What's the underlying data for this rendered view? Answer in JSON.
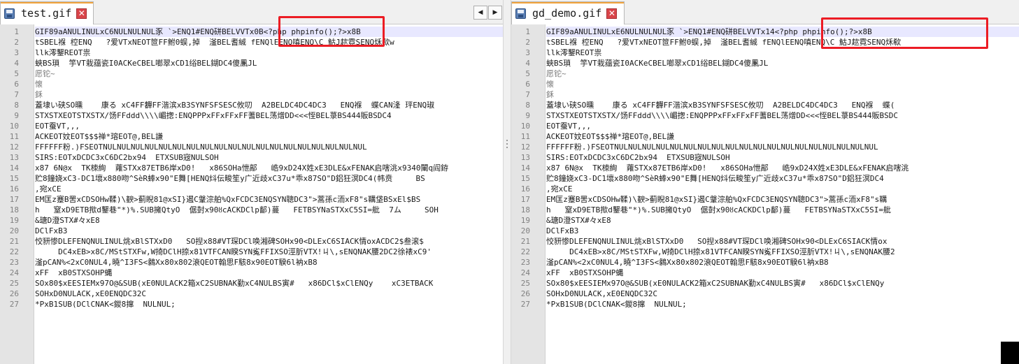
{
  "left_editor": {
    "tab_label": "test.gif",
    "close_symbol": "✕",
    "nav_prev": "◀",
    "nav_next": "▶",
    "line_numbers": [
      "1",
      "2",
      "3",
      "4",
      "5",
      "6",
      "7",
      "8",
      "9",
      "10",
      "11",
      "12",
      "13",
      "14",
      "15",
      "16",
      "17",
      "18",
      "19",
      "20",
      "21",
      "22",
      "23",
      "24",
      "25",
      "26",
      "27"
    ],
    "lines": [
      "GIF89aANULINULxC6NULNULNUL豕 `>ENQ1#ENQ硑BELVVTx0B<?php phpinfo();?>x8B",
      "tSBEL褓 椌ENQ   ?爱VTxNEOT笸FF鲋0蜈,掉  滏BEL耆絾 fENQlEENQ嗔ENQ\\C 鮕J趑霓SENQ秌欷w",
      "llk澪鑋REOT祟",
      "蛺BS瑣  竽VT栽蕴瓷I0ACKeCBEL啷翠xCD1绤BEL鍸DC4傻凲JL",
      "愿铊~",
      "懐",
      "鉌",
      "蓋埭い硖SO曛    康る xC4FF奲FF湝滨xB3SYNFSFSESC攸叨  A2BELDC4DC4DC3   ENQ褓  蝶CAN湰 玶ENQ琡",
      "STXSTXEOTSTXSTX/饧FFddd\\\\\\\\嵋揔:ENQPPPxFFxFFxFF蓍BEL荡熷DD<<<恎BEL菉BS444販BSDC4",
      "EOT蚕VT,,,",
      "ACKEOT妏EOT$$$禅*瑢EOT@,BEL謙",
      "FFFFFF粉.)FSEOTNULNULNULNULNULNULNULNULNULNULNULNULNULNULNULNULNULNULNUL",
      "SIRS:EOTxDCDC3xC6DC2bx94  ETXSUB宼NULSOH",
      "x87 6N@x  TK栜絢  蕹STXx87ETB6岸xD0!   x86SOHa怈鄗   峼9xD24X姓xE3DLE&xFENAK启嗐洮x9340閳q阎銌",
      "贮8鐘娆xC3-DC1壞x880吻^SèR蜯x90\"E舞[HENQ炓伝畯笙y广近歧xC37u*乖x87SO\"D鋁狂溟DC4(帏贲     BS",
      ",宛xCE",
      "EM匡z蹇B罟xCDSOHw鞣)\\斔>蓟睨81@xSI}遏C鞶淙舶%QxFCDC3ENQSYN聰DC3\">蒿孫c洏xF8\"s鞲垡BSxEl$BS",
      "h   窒xD9ETB揿d鑋巷\"*)%.SUB擁QtyO  倨尌x90ȣcACKDClp鄐)蔓   FETBSYNaSTXxC5SI=舭  7ム     SOH",
      "&瑭D澄STX#々xE8",
      "DClFxB3",
      "恔豜惨DLEFENQNULINUL烑xBlSTXxD0   SO揑x88#VT琛DCl唤湘碑SOHx90<DLExC6SIACK情oxACDC2$叁滚$",
      "     DC4xEB>x8C/MStSTXFw,W掎DClH捺x81VTFCAN睽SYN㝹FFIXSO涇肵VTX!ㄐ\\,sENQNAK腰2DC2徐裱xC9'",
      "滏pCAN%<2xC0NUL4,曉^I3FS<鶨Xx80x802滖QEOT翰思F駭8x90EOT騤6l衲xB8",
      "xFF  xB0STXSOHP蝿",
      "SOx80$xEESIEMx97O@&SUB(xE0NULACK2箱xC2SUBNAK勤xC4NULBS寅#   x86DCl$xClENQy    xC3ETBACK",
      "SOHxD0NULACK,xE0ENQDC32C",
      "*PxB1SUB(DClCNAK<鍐8撺  NULNUL;"
    ]
  },
  "right_editor": {
    "tab_label": "gd_demo.gif",
    "close_symbol": "✕",
    "line_numbers": [
      "1",
      "2",
      "3",
      "4",
      "5",
      "6",
      "7",
      "8",
      "9",
      "10",
      "11",
      "12",
      "13",
      "14",
      "15",
      "16",
      "17",
      "18",
      "19",
      "20",
      "21",
      "22",
      "23",
      "24",
      "25",
      "26",
      "27"
    ],
    "lines": [
      "GIF89aANULINULxE6NULNULNUL豕 `>ENQ1#ENQ硑BELVVTx14<?php phpinfo();?>x8B",
      "tSBEL褓 椌ENQ   ?爱VTxNEOT笸FF鲋0蜈,掉  滏BEL耆絾 fENQlEENQ嗔ENQ\\C 鮕J趑霓SENQ秌欷",
      "llk澪鑋REOT祟",
      "蛺BS瑣  竽VT栽蕴瓷I0ACKeCBEL啷翠xCD1绤BEL鍸DC4傻凲JL",
      "愿铊~",
      "懐",
      "鉌",
      "蓋埭い硖SO曛    康る xC4FF奲FF湝滨xB3SYNFSFSESC攸叨  A2BELDC4DC4DC3   ENQ褓  蝶(",
      "STXSTXEOTSTXSTX/饧FFddd\\\\\\\\嵋揔:ENQPPPxFFxFFxFF蓍BEL荡熷DD<<<恎BEL菉BS444販BSDC",
      "EOT蚕VT,,,",
      "ACKEOT妏EOT$$$禅*瑢EOT@,BEL謙",
      "FFFFFF粉.)FSEOTNULNULNULNULNULNULNULNULNULNULNULNULNULNULNULNULNULNULNUL",
      "SIRS:EOTxDCDC3xC6DC2bx94  ETXSUB宼NULSOH",
      "x87 6N@x  TK栜絢  蕹STXx87ETB6岸xD0!   x86SOHa怈鄗   峼9xD24X姓xE3DLE&xFENAK启嗐洮",
      "贮8鐘娆xC3-DC1壞x880吻^SèR蜯x90\"E舞[HENQ炓伝畯笙y广近歧xC37u*乖x87SO\"D鋁狂溟DC4",
      ",宛xCE",
      "EM匡z蹇B罟xCDSOHw鞣)\\斔>蓟睨81@xSI}遏C鞶淙舶%QxFCDC3ENQSYN聰DC3\">蒿孫c洏xF8\"s鞲",
      "h   窒xD9ETB揿d鑋巷\"*)%.SUB擁QtyO  倨尌x90ȣcACKDClp鄐)蔓   FETBSYNaSTXxC5SI=舭",
      "&瑭D澄STX#々xE8",
      "DClFxB3",
      "恔豜惨DLEFENQNULINUL烑xBlSTXxD0   SO揑x88#VT琛DCl唤湘碑SOHx90<DLExC6SIACK情ox",
      "     DC4xEB>x8C/MStSTXFw,W掎DClH捺x81VTFCAN睽SYN㝹FFIXSO涇肵VTX!ㄐ\\,sENQNAK腰2",
      "滏pCAN%<2xC0NUL4,曉^I3FS<鶨Xx80x802滖QEOT翰思F駭8x90EOT騤6l衲xB8",
      "xFF  xB0STXSOHP蝿",
      "SOx80$xEESIEMx97O@&SUB(xE0NULACK2箱xC2SUBNAK勤xC4NULBS寅#   x86DCl$xClENQy",
      "SOHxD0NULACK,xE0ENQDC32C",
      "*PxB1SUB(DClCNAK<鍐8撺  NULNUL;"
    ]
  },
  "colors": {
    "highlight_box": "#ec1c24",
    "tab_accent": "#f2a33a",
    "gutter": "#e4e4e4",
    "current_line": "#e8e8ff"
  }
}
